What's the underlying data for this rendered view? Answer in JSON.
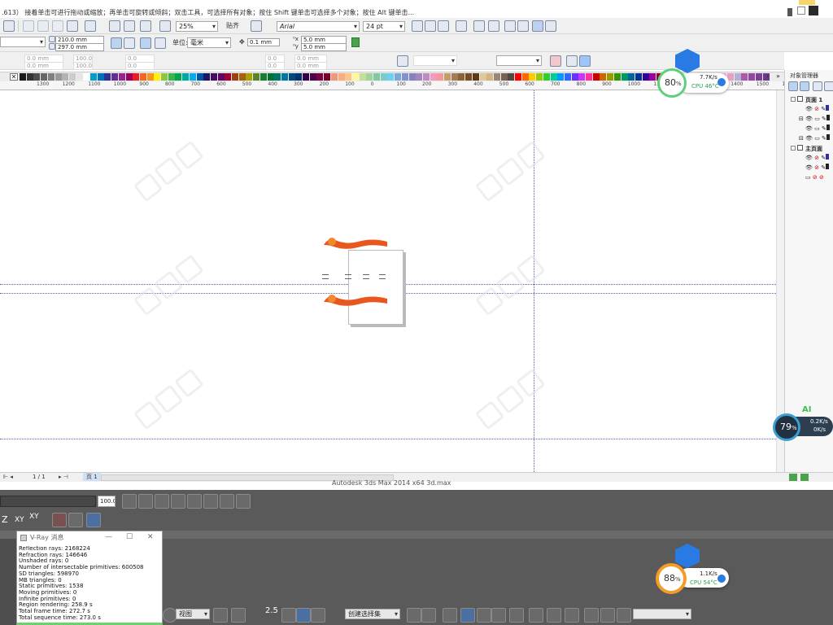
{
  "title_bar": {
    "hint": ".613）  接着单击可进行拖动或缩放；再单击可旋转或倾斜；双击工具，可选择所有对象；按住 Shift 键单击可选择多个对象；按住 Alt 键单击..."
  },
  "toolbar1": {
    "zoom": "25%",
    "snap_label": "贴齐",
    "font_name": "Arial",
    "font_size": "24 pt"
  },
  "property_bar": {
    "width": "210.0 mm",
    "height": "297.0 mm",
    "unit_label": "单位:",
    "unit_value": "毫米",
    "nudge": "0.1 mm",
    "dup_x": "5.0 mm",
    "dup_y": "5.0 mm"
  },
  "property_bar2": {
    "x1": "0.0 mm",
    "x2": "0.0 mm",
    "s1": "100.0",
    "s2": "100.0",
    "r1": "0.0",
    "r2": "0.0",
    "o1": "0.0",
    "o2": "0.0",
    "p1": "0.0 mm",
    "p2": "0.0 mm"
  },
  "ruler_ticks": [
    "1300",
    "1200",
    "1100",
    "1000",
    "900",
    "800",
    "700",
    "600",
    "500",
    "400",
    "300",
    "200",
    "100",
    "0",
    "100",
    "200",
    "300",
    "400",
    "500",
    "600",
    "700",
    "800",
    "900",
    "1000",
    "1100",
    "1200",
    "1300",
    "1400",
    "1500",
    "1600"
  ],
  "palette": [
    "#1a1a1a",
    "#333333",
    "#4d4d4d",
    "#666666",
    "#808080",
    "#999999",
    "#b3b3b3",
    "#cccccc",
    "#e6e6e6",
    "#ffffff",
    "#00a0c6",
    "#0072bc",
    "#2e3192",
    "#662d91",
    "#92278f",
    "#9e005d",
    "#ed1c24",
    "#f26522",
    "#f7941d",
    "#fff200",
    "#8dc63f",
    "#39b54a",
    "#00a651",
    "#00a99d",
    "#00aeef",
    "#0054a6",
    "#1b1464",
    "#440e62",
    "#630460",
    "#9e0039",
    "#a0410d",
    "#a36209",
    "#aba000",
    "#598527",
    "#197b30",
    "#007236",
    "#00746b",
    "#0076a3",
    "#004a80",
    "#003471",
    "#32004b",
    "#4b0049",
    "#7b0046",
    "#7a0026",
    "#f69679",
    "#f9ad81",
    "#fdc689",
    "#fff79a",
    "#c4df9b",
    "#a3d39c",
    "#82ca9d",
    "#7accc8",
    "#6dcff6",
    "#7da7d9",
    "#8393ca",
    "#8781bd",
    "#a187be",
    "#bd8cbf",
    "#f49ac1",
    "#f5989d",
    "#c69c6d",
    "#a67c52",
    "#8c6239",
    "#754c24",
    "#603913",
    "#e0c89e",
    "#d4b483",
    "#998675",
    "#736357",
    "#534741",
    "#ff0000",
    "#ff6600",
    "#ffcc00",
    "#99cc00",
    "#33cc33",
    "#00cc99",
    "#0099ff",
    "#3366ff",
    "#6633ff",
    "#cc33ff",
    "#ff3399",
    "#cc0000",
    "#cc6600",
    "#999900",
    "#339900",
    "#009966",
    "#006699",
    "#003399",
    "#330099",
    "#990099",
    "#990033",
    "#cc3366",
    "#ff99cc",
    "#ffcc99",
    "#ffff99",
    "#ccff99",
    "#99ffcc",
    "#99ccff",
    "#cc99ff",
    "#ff99ff",
    "#e6a0c4",
    "#b0b0d8",
    "#ad59a8",
    "#8f4a9e",
    "#7f3f98",
    "#6a3a8c"
  ],
  "object_manager": {
    "title": "对象管理器",
    "page1": "页面 1",
    "master": "主页面"
  },
  "monitor_top": {
    "percent": "80",
    "unit": "%",
    "net": "7.7K/s",
    "cpu_label": "CPU",
    "cpu_temp": "46°C"
  },
  "monitor_right": {
    "ai": "AI",
    "percent": "79",
    "unit": "%",
    "up": "0.2K/s",
    "down": "0K/s"
  },
  "monitor_bottom": {
    "percent": "88",
    "unit": "%",
    "net": "1.1K/s",
    "cpu_label": "CPU",
    "cpu_temp": "54°C"
  },
  "status_bar": {
    "page_nav": "1 / 1",
    "page_tab": "页 1",
    "center_text": "Autodesk 3ds Max  2014 x64      3d.max"
  },
  "max_toolbar": {
    "spin_value": "100.0",
    "axis_xy": "XY",
    "axis_xy2": "XY",
    "axis_z": "Z",
    "view_combo": "视图",
    "sel_combo": "创建选择集",
    "zoom_label": "2.5"
  },
  "vray": {
    "title": "V-Ray 消息",
    "lines": [
      "Reflection rays: 2168224",
      "Refraction rays: 146646",
      "Unshaded rays: 0",
      "Number of intersectable primitives: 600508",
      "SD triangles: 598970",
      "MB triangles: 0",
      "Static primitives: 1538",
      "Moving primitives: 0",
      "Infinite primitives: 0",
      "Region rendering: 258.9 s",
      "Total frame time: 272.7 s",
      "Total sequence time: 273.0 s"
    ]
  },
  "colors": {
    "accent_orange": "#e8581e",
    "guide": "#5560b8",
    "max_dark": "#5a5a5a"
  }
}
